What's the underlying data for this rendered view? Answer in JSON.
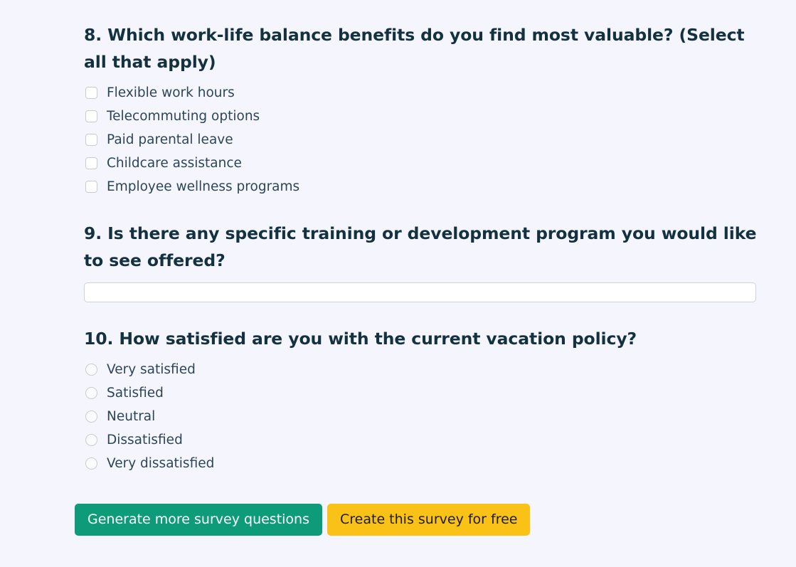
{
  "questions": [
    {
      "number": "8",
      "heading": "8. Which work-life balance benefits do you find most valuable? (Select all that apply)",
      "type": "checkbox",
      "options": [
        "Flexible work hours",
        "Telecommuting options",
        "Paid parental leave",
        "Childcare assistance",
        "Employee wellness programs"
      ]
    },
    {
      "number": "9",
      "heading": "9. Is there any specific training or development program you would like to see offered?",
      "type": "text",
      "input_value": "",
      "input_placeholder": ""
    },
    {
      "number": "10",
      "heading": "10. How satisfied are you with the current vacation policy?",
      "type": "radio",
      "options": [
        "Very satisfied",
        "Satisfied",
        "Neutral",
        "Dissatisfied",
        "Very dissatisfied"
      ]
    }
  ],
  "actions": {
    "generate_label": "Generate more survey questions",
    "create_label": "Create this survey for free"
  },
  "colors": {
    "background": "#f5f5fd",
    "heading_text": "#14313f",
    "option_text": "#2d4655",
    "generate_button": "#0d9b7a",
    "generate_button_text": "#ffffff",
    "create_button": "#fac217",
    "create_button_text": "#1c1c1c",
    "control_border": "#c8cbd4",
    "input_border": "#cfd2db",
    "input_background": "#ffffff"
  }
}
